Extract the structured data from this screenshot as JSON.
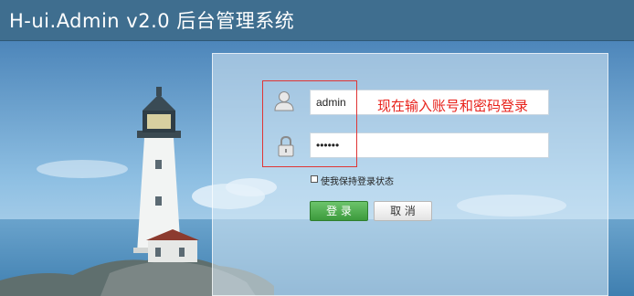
{
  "header": {
    "title": "H-ui.Admin v2.0 后台管理系统"
  },
  "login": {
    "username_value": "admin",
    "password_mask": "••••••",
    "remember_label": "使我保持登录状态",
    "login_button": "登 录",
    "cancel_button": "取 消"
  },
  "annotation": {
    "text": "现在输入账号和密码登录"
  },
  "colors": {
    "header_bg": "#3f6e8f",
    "annotation_red": "#e8221b",
    "login_green": "#3c9a3c"
  },
  "icons": {
    "user": "user-icon",
    "lock": "lock-icon"
  }
}
